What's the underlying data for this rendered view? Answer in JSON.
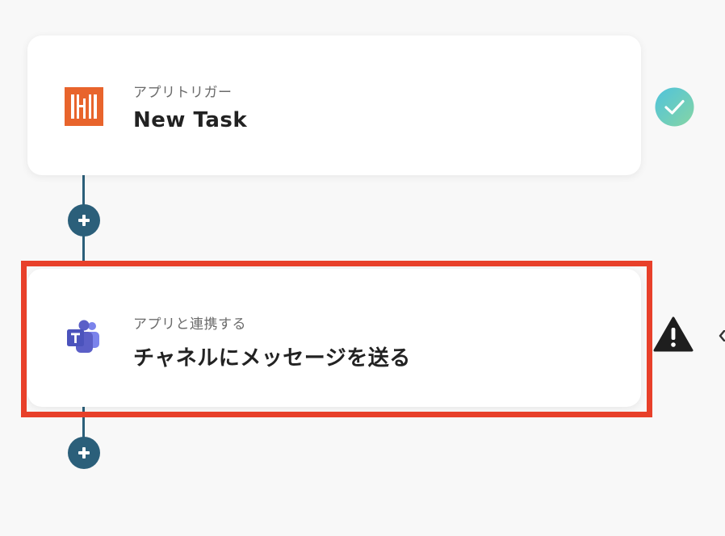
{
  "flow": {
    "steps": [
      {
        "type_label": "アプリトリガー",
        "title": "New Task",
        "app_icon": "hive-logo-icon",
        "status": "completed",
        "status_icon": "check-circle-icon"
      },
      {
        "type_label": "アプリと連携する",
        "title": "チャネルにメッセージを送る",
        "app_icon": "microsoft-teams-logo-icon",
        "status": "warning",
        "status_icon": "warning-triangle-icon",
        "highlighted": true
      }
    ],
    "add_step_icon": "plus-icon"
  },
  "colors": {
    "connector": "#2b5f7a",
    "highlight_border": "#e8402a",
    "success_gradient": [
      "#56c6d8",
      "#7fd1a8"
    ],
    "warning": "#1e1e1e",
    "hive_brand": "#e8642c",
    "teams_brand": "#5b5fc7"
  }
}
